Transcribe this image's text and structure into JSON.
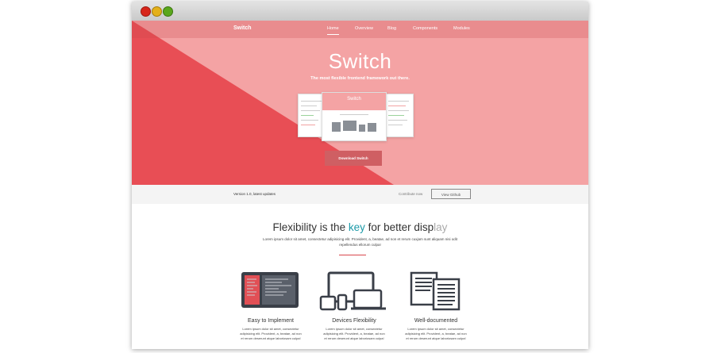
{
  "nav": {
    "brand": "Switch",
    "items": [
      "Home",
      "Overview",
      "Blog",
      "Components",
      "Modules"
    ]
  },
  "hero": {
    "title": "Switch",
    "subtitle": "The most flexible frontend framework out there.",
    "mock_title": "Switch",
    "download_label": "Download Switch"
  },
  "strip": {
    "version": "Version 1.0, latest updates",
    "contribute": "Contribute now",
    "github_label": "View Github"
  },
  "content": {
    "headline_pre": "Flexibility is the",
    "headline_key": "key",
    "headline_post": "for better disp",
    "headline_fade": "lay",
    "lead": "Lorem ipsum dolor sit amet, consectetur adipisicing elit. Provident, a, beatae, ad non et rerum cuxjam sunt aliquam nisi odit repellendus ellorum culpa!"
  },
  "features": [
    {
      "title": "Easy to Implement",
      "text": "Lorem ipsum dolor sit amet, consectetur adipisicing elit. Provident, a, beatae, ad non et rerum deserunt atque laboriosam culpa!"
    },
    {
      "title": "Devices Flexibility",
      "text": "Lorem ipsum dolor sit amet, consectetur adipisicing elit. Provident, a, beatae, ad non et rerum deserunt atque laboriosam culpa!"
    },
    {
      "title": "Well-documented",
      "text": "Lorem ipsum dolor sit amet, consectetur adipisicing elit. Provident, a, beatae, ad non et rerum deserunt atque laboriosam culpa!"
    }
  ],
  "colors": {
    "hero_light": "#f4a3a4",
    "hero_dark": "#e84e55",
    "accent": "#1c9aa8",
    "divider": "#d9474d"
  }
}
